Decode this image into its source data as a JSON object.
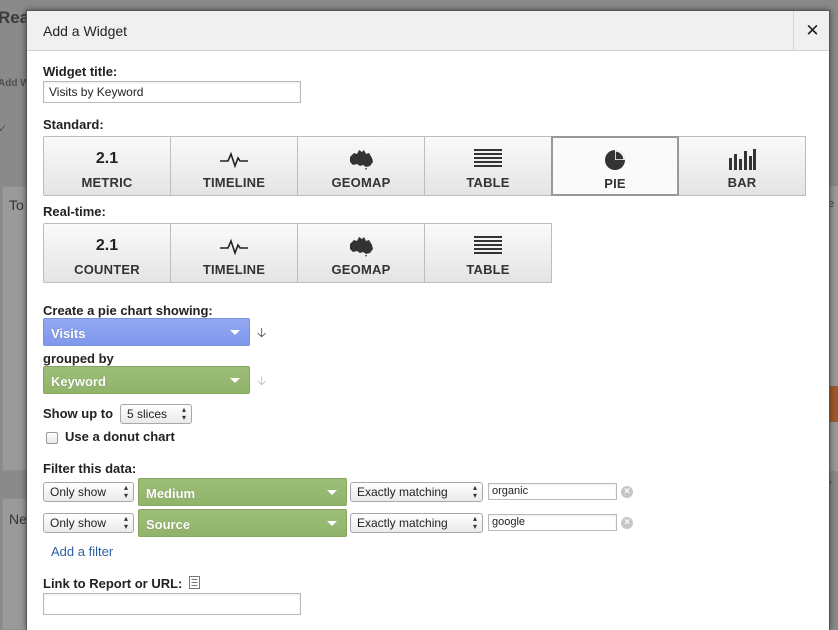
{
  "background": {
    "page_title": "Rea",
    "add_widget_link": "Add W",
    "card_left_text": "To",
    "card_left2_text": "Ne",
    "right_card_text": "e",
    "right_card2_text": "v"
  },
  "dialog": {
    "title": "Add a Widget",
    "close_glyph": "✕",
    "widget_title_label": "Widget title:",
    "widget_title_value": "Visits by Keyword",
    "standard_label": "Standard:",
    "standard_types": [
      {
        "label": "METRIC",
        "icon": "2.1"
      },
      {
        "label": "TIMELINE",
        "icon": "timeline-icon"
      },
      {
        "label": "GEOMAP",
        "icon": "australia-map-icon"
      },
      {
        "label": "TABLE",
        "icon": "table-icon"
      },
      {
        "label": "PIE",
        "icon": "pie-icon",
        "selected": true
      },
      {
        "label": "BAR",
        "icon": "bar-icon"
      }
    ],
    "realtime_label": "Real-time:",
    "realtime_types": [
      {
        "label": "COUNTER",
        "icon": "2.1"
      },
      {
        "label": "TIMELINE",
        "icon": "timeline-icon"
      },
      {
        "label": "GEOMAP",
        "icon": "australia-map-icon"
      },
      {
        "label": "TABLE",
        "icon": "table-icon"
      }
    ],
    "pie_showing_label": "Create a pie chart showing:",
    "metric_value": "Visits",
    "grouped_by_label": "grouped by",
    "dimension_value": "Keyword",
    "show_up_to_label": "Show up to",
    "slices_value": "5 slices",
    "donut_label": "Use a donut chart",
    "donut_checked": false,
    "filter_label": "Filter this data:",
    "filters": [
      {
        "show": "Only show",
        "dimension": "Medium",
        "match": "Exactly matching",
        "value": "organic"
      },
      {
        "show": "Only show",
        "dimension": "Source",
        "match": "Exactly matching",
        "value": "google"
      }
    ],
    "add_filter_label": "Add a filter",
    "link_label": "Link to Report or URL:",
    "link_value": ""
  },
  "colors": {
    "metric_dropdown": "#8ba0ef",
    "dimension_dropdown": "#97b871",
    "link": "#2d5fa8"
  }
}
